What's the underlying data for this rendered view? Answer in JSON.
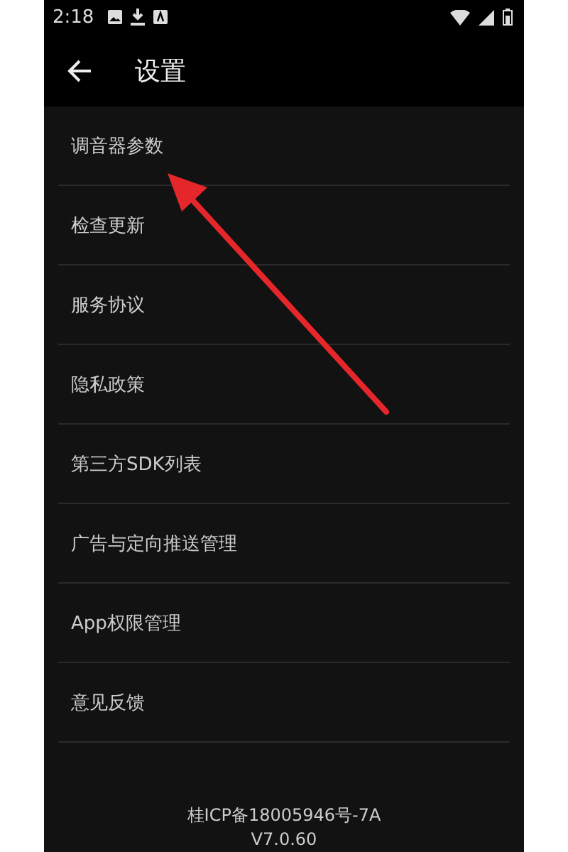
{
  "status_bar": {
    "time": "2:18"
  },
  "header": {
    "title": "设置"
  },
  "items": [
    {
      "label": "调音器参数"
    },
    {
      "label": "检查更新"
    },
    {
      "label": "服务协议"
    },
    {
      "label": "隐私政策"
    },
    {
      "label": "第三方SDK列表"
    },
    {
      "label": "广告与定向推送管理"
    },
    {
      "label": "App权限管理"
    },
    {
      "label": "意见反馈"
    }
  ],
  "footer": {
    "license": "桂ICP备18005946号-7A",
    "version": "V7.0.60"
  }
}
